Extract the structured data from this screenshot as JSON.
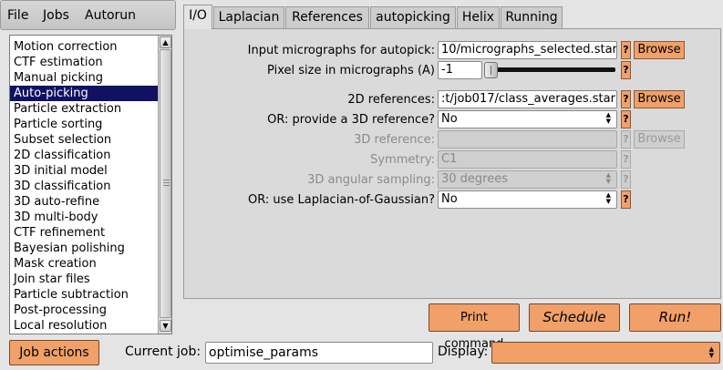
{
  "menubar": {
    "items": [
      "File",
      "Jobs",
      "Autorun"
    ]
  },
  "job_list": {
    "selected_index": 3,
    "items": [
      "Motion correction",
      "CTF estimation",
      "Manual picking",
      "Auto-picking",
      "Particle extraction",
      "Particle sorting",
      "Subset selection",
      "2D classification",
      "3D initial model",
      "3D classification",
      "3D auto-refine",
      "3D multi-body",
      "CTF refinement",
      "Bayesian polishing",
      "Mask creation",
      "Join star files",
      "Particle subtraction",
      "Post-processing",
      "Local resolution"
    ]
  },
  "tabs": [
    "I/O",
    "Laplacian",
    "References",
    "autopicking",
    "Helix",
    "Running"
  ],
  "active_tab": "I/O",
  "io": {
    "input_micrographs": {
      "label": "Input micrographs for autopick:",
      "value": "10/micrographs_selected.star",
      "help": "?",
      "browse": "Browse"
    },
    "pixel_size": {
      "label": "Pixel size in micrographs (A)",
      "value": "-1",
      "help": "?",
      "slider_level": 0
    },
    "references_2d": {
      "label": "2D references:",
      "value": ":t/job017/class_averages.star",
      "help": "?",
      "browse": "Browse"
    },
    "reference_3d_option": {
      "label": "OR: provide a 3D reference?",
      "value": "No",
      "help": "?"
    },
    "reference_3d": {
      "label": "3D reference:",
      "value": "",
      "help": "?",
      "browse": "Browse"
    },
    "symmetry": {
      "label": "Symmetry:",
      "value": "C1",
      "help": "?"
    },
    "angular_sampling": {
      "label": "3D angular sampling:",
      "value": "30 degrees",
      "help": "?"
    },
    "laplacian": {
      "label": "OR: use Laplacian-of-Gaussian?",
      "value": "No",
      "help": "?"
    }
  },
  "actions": {
    "print": "Print command",
    "schedule": "Schedule",
    "run": "Run!"
  },
  "footer": {
    "job_actions": "Job actions",
    "current_job_label": "Current job:",
    "current_job_value": "optimise_params",
    "display_label": "Display:",
    "display_value": ""
  },
  "colors": {
    "accent": "#f0a068",
    "selection": "#111164"
  }
}
